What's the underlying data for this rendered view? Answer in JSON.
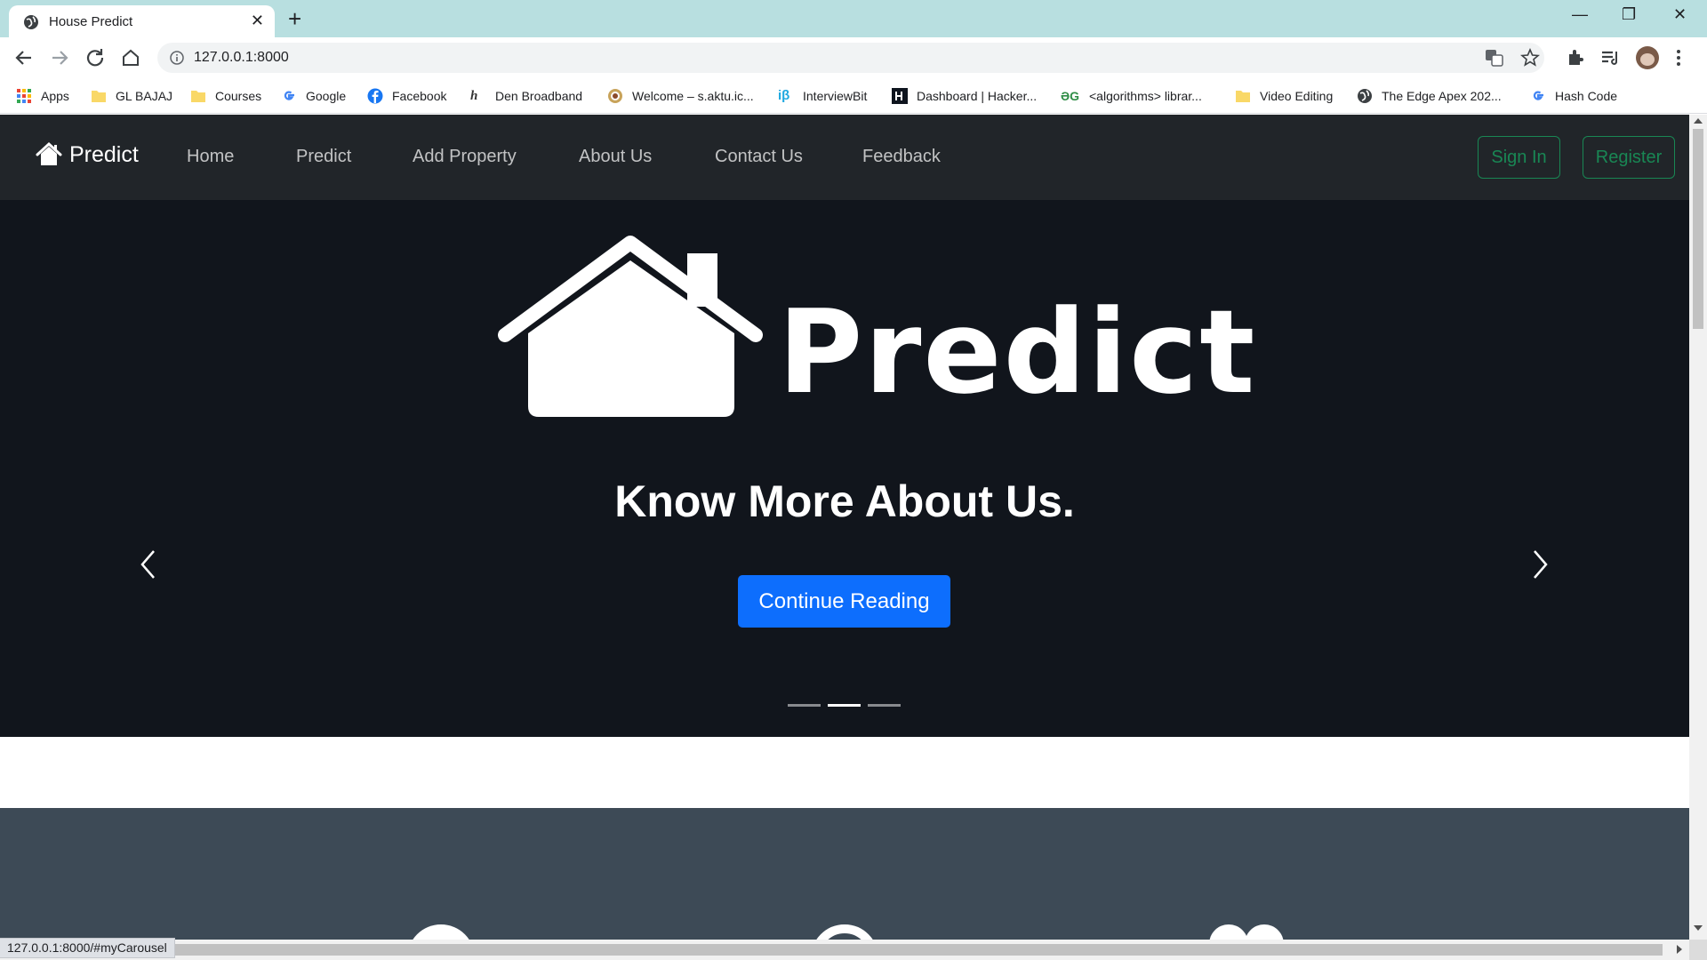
{
  "browser": {
    "tab_title": "House Predict",
    "tab_close": "✕",
    "new_tab": "+",
    "url": "127.0.0.1:8000",
    "window_controls": {
      "minimize": "—",
      "maximize": "❐",
      "close": "✕"
    }
  },
  "bookmarks": [
    {
      "label": "Apps",
      "icon": "apps-grid-icon"
    },
    {
      "label": "GL BAJAJ",
      "icon": "folder-icon"
    },
    {
      "label": "Courses",
      "icon": "folder-icon"
    },
    {
      "label": "Google",
      "icon": "google-icon"
    },
    {
      "label": "Facebook",
      "icon": "facebook-icon"
    },
    {
      "label": "Den Broadband",
      "icon": "den-icon"
    },
    {
      "label": "Welcome – s.aktu.ic...",
      "icon": "aktu-icon"
    },
    {
      "label": "InterviewBit",
      "icon": "interviewbit-icon"
    },
    {
      "label": "Dashboard | Hacker...",
      "icon": "hackerrank-icon"
    },
    {
      "label": "<algorithms> librar...",
      "icon": "gfg-icon"
    },
    {
      "label": "Video Editing",
      "icon": "folder-icon"
    },
    {
      "label": "The Edge Apex 202...",
      "icon": "globe-icon"
    },
    {
      "label": "Hash Code",
      "icon": "google-icon"
    }
  ],
  "navbar": {
    "brand": "Predict",
    "links": [
      "Home",
      "Predict",
      "Add Property",
      "About Us",
      "Contact Us",
      "Feedback"
    ],
    "sign_in": "Sign In",
    "register": "Register"
  },
  "carousel": {
    "logo_text": "Predict",
    "heading": "Know More About Us.",
    "button": "Continue Reading",
    "slides": 3,
    "active_slide": 2
  },
  "status_bar": "127.0.0.1:8000/#myCarousel",
  "colors": {
    "tabstrip": "#b8dfe0",
    "navbar": "#212529",
    "carousel": "#11151c",
    "primary": "#0d6efd",
    "success": "#198754",
    "features": "#3d4a56"
  }
}
